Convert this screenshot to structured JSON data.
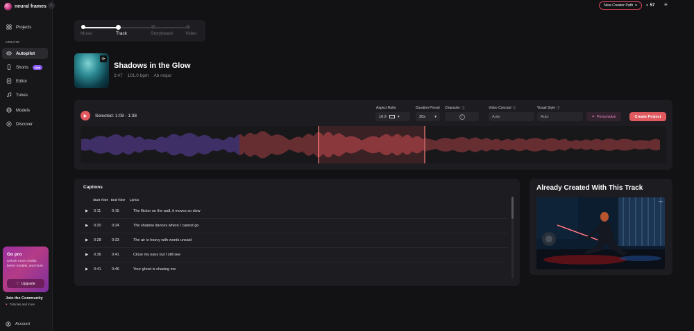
{
  "app": {
    "brand": "neural frames",
    "collapse_icon": "chevron-left-icon"
  },
  "sidebar": {
    "projects": "Projects",
    "section_create": "CREATE",
    "items": [
      {
        "label": "Autopilot",
        "icon": "autopilot-icon",
        "active": true
      },
      {
        "label": "Shorts",
        "icon": "phone-icon",
        "badge": "New"
      },
      {
        "label": "Editor",
        "icon": "editor-icon"
      },
      {
        "label": "Tunes",
        "icon": "music-note-icon"
      },
      {
        "label": "Models",
        "icon": "globe-icon"
      },
      {
        "label": "Discover",
        "icon": "compass-icon"
      }
    ],
    "gopro": {
      "title": "Go pro",
      "text": "Unlock more credits, better models, and more.",
      "button": "Upgrade"
    },
    "community": {
      "title": "Join the Community",
      "sub": "Tutorials and more"
    },
    "account": "Account"
  },
  "topbar": {
    "creator_path": "New Creator Path",
    "credits": "57"
  },
  "stepper": {
    "steps": [
      "Music",
      "Track",
      "Storyboard",
      "Video"
    ],
    "current": "Track"
  },
  "track": {
    "title": "Shadows in the Glow",
    "duration": "2:47",
    "bpm": "101.0 bpm",
    "key": "Ab major"
  },
  "controls": {
    "selected": "Selected: 1:08 - 1:38",
    "aspect_label": "Aspect Ratio",
    "aspect_value": "16:9",
    "duration_label": "Duration Preset",
    "duration_value": "30s",
    "character_label": "Character",
    "concept_label": "Video Concept",
    "concept_value": "Auto",
    "style_label": "Visual Style",
    "style_value": "Auto",
    "personalize": "Personalize",
    "create": "Create Project"
  },
  "captions": {
    "title": "Captions",
    "headers": [
      "Start Time",
      "End Time",
      "Lyrics"
    ],
    "rows": [
      {
        "start": "0:11",
        "end": "0:15",
        "lyric": "The flicker on the wall, it moves so slow"
      },
      {
        "start": "0:20",
        "end": "0:24",
        "lyric": "The shadow dances where I cannot go"
      },
      {
        "start": "0:28",
        "end": "0:33",
        "lyric": "The air is heavy with words unsaid"
      },
      {
        "start": "0:36",
        "end": "0:41",
        "lyric": "Close my eyes but I still see"
      },
      {
        "start": "0:41",
        "end": "0:46",
        "lyric": "Your ghost is chasing me"
      }
    ]
  },
  "already": {
    "title": "Already Created With This Track",
    "more": "..."
  },
  "colors": {
    "accent": "#e05a5f",
    "purple_wave": "#6f4cc4",
    "red_wave": "#c94a4f",
    "badge": "#8b5cf6"
  }
}
